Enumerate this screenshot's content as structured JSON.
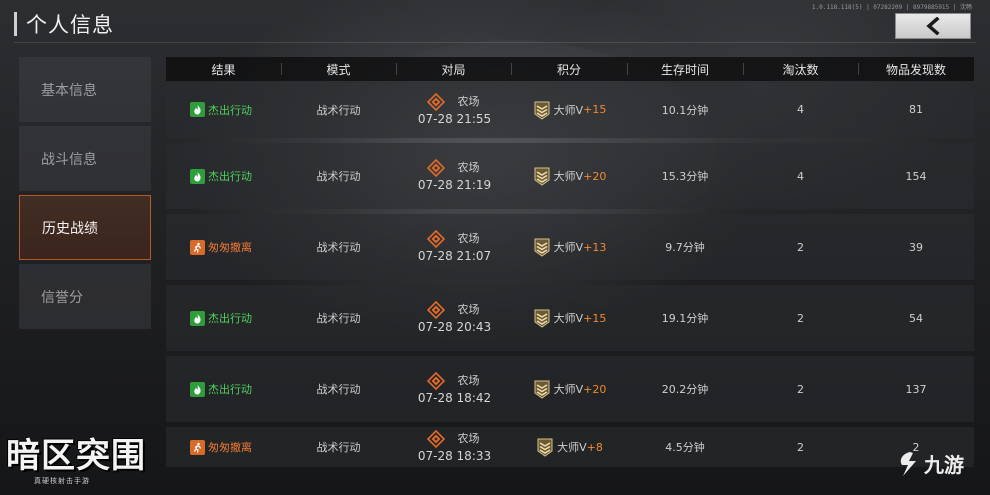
{
  "header": {
    "title": "个人信息",
    "status_text": "1.0.118.118(5) | 07282209 | 8979885915 | 沈畅"
  },
  "back_button": {
    "icon": "back-arrow-icon"
  },
  "sidebar": {
    "items": [
      {
        "label": "基本信息",
        "active": false
      },
      {
        "label": "战斗信息",
        "active": false
      },
      {
        "label": "历史战绩",
        "active": true
      },
      {
        "label": "信誉分",
        "active": false
      }
    ]
  },
  "table": {
    "headers": [
      "结果",
      "模式",
      "对局",
      "积分",
      "生存时间",
      "淘汰数",
      "物品发现数"
    ],
    "rows": [
      {
        "result": "杰出行动",
        "result_type": "success",
        "mode": "战术行动",
        "map": "农场",
        "time": "07-28 21:55",
        "rank": "大师V",
        "delta": "+15",
        "survival": "10.1分钟",
        "eliminations": "4",
        "items": "81"
      },
      {
        "result": "杰出行动",
        "result_type": "success",
        "mode": "战术行动",
        "map": "农场",
        "time": "07-28 21:19",
        "rank": "大师V",
        "delta": "+20",
        "survival": "15.3分钟",
        "eliminations": "4",
        "items": "154"
      },
      {
        "result": "匆匆撤离",
        "result_type": "hasty",
        "mode": "战术行动",
        "map": "农场",
        "time": "07-28 21:07",
        "rank": "大师V",
        "delta": "+13",
        "survival": "9.7分钟",
        "eliminations": "2",
        "items": "39"
      },
      {
        "result": "杰出行动",
        "result_type": "success",
        "mode": "战术行动",
        "map": "农场",
        "time": "07-28 20:43",
        "rank": "大师V",
        "delta": "+15",
        "survival": "19.1分钟",
        "eliminations": "2",
        "items": "54"
      },
      {
        "result": "杰出行动",
        "result_type": "success",
        "mode": "战术行动",
        "map": "农场",
        "time": "07-28 18:42",
        "rank": "大师V",
        "delta": "+20",
        "survival": "20.2分钟",
        "eliminations": "2",
        "items": "137"
      },
      {
        "result": "匆匆撤离",
        "result_type": "hasty",
        "mode": "战术行动",
        "map": "农场",
        "time": "07-28 18:33",
        "rank": "大师V",
        "delta": "+8",
        "survival": "4.5分钟",
        "eliminations": "2",
        "items": "2"
      }
    ]
  },
  "colors": {
    "success": "#4fd15c",
    "hasty": "#ef7a35",
    "score_delta": "#f08a30",
    "active_border": "#b55a2a"
  },
  "logo": {
    "title": "暗区突围",
    "subtitle": "真硬核射击手游"
  },
  "watermark": {
    "text": "九游"
  }
}
